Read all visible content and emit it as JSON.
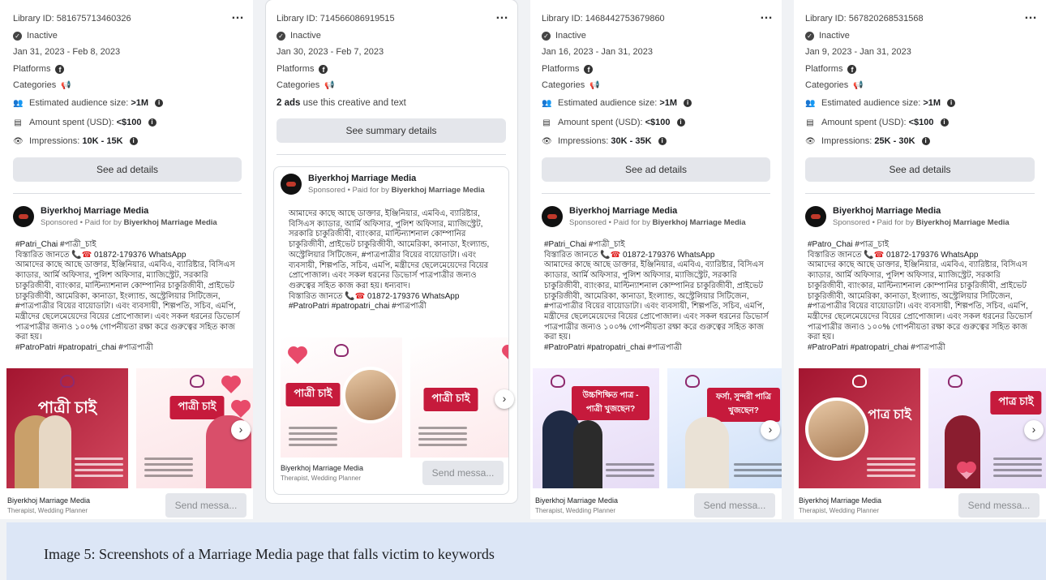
{
  "cards": [
    {
      "library_id": "Library ID: 581675713460326",
      "status": "Inactive",
      "dates": "Jan 31, 2023 - Feb 8, 2023",
      "platforms_label": "Platforms",
      "categories_label": "Categories",
      "audience_label": "Estimated audience size:",
      "audience_value": ">1M",
      "amount_label": "Amount spent (USD):",
      "amount_value": "<$100",
      "impressions_label": "Impressions:",
      "impressions_value": "10K - 15K",
      "details_button": "See ad details",
      "page_name": "Biyerkhoj Marriage Media",
      "sponsored": "Sponsored • Paid for by",
      "paid_by": "Biyerkhoj Marriage Media",
      "hashtag_top": "#Patri_Chai #পাত্রী_চাই",
      "contact_prefix": "বিস্তারিত জানতে",
      "contact_number": "01872-179376 WhatsApp",
      "body_text": "আমাদের কাছে আছে ডাক্তার, ইঞ্জিনিয়ার, এমবিএ, ব্যারিষ্টার, বিসিএস ক্যাডার, আর্মি অফিসার, পুলিশ অফিসার, ম্যাজিস্ট্রেট, সরকারি চাকুরিজীবী, ব্যাংকার, মাল্টিন্যাশনাল কোম্পানির চাকুরিজীবী, প্রাইভেট চাকুরিজীবী, আমেরিকা, কানাডা, ইংল্যান্ড, অস্ট্রেলিয়ার সিটিজেন, #পাত্রপাত্রীর বিয়ের বায়োডাটা। এবং ব্যবসায়ী, শিল্পপতি, সচিব, এমপি, মন্ত্রীদের ছেলেমেয়েদের বিয়ের প্রোপোজাল। এবং সকল ধরনের ডিভোর্স পাত্রপাত্রীর জন্যও ১০০% গোপনীয়তা রক্ষা করে গুরুত্বের সহিত কাজ করা হয়।",
      "hashtag_bottom": "#PatroPatri #patropatri_chai #পাত্রপাত্রী",
      "slide_tags": [
        "পাত্রী চাই",
        "পাত্রী চাই"
      ],
      "footer_name": "Biyerkhoj Marriage Media",
      "footer_sub": "Therapist, Wedding Planner",
      "send_button": "Send messa..."
    },
    {
      "library_id": "Library ID: 714566086919515",
      "status": "Inactive",
      "dates": "Jan 30, 2023 - Feb 7, 2023",
      "platforms_label": "Platforms",
      "categories_label": "Categories",
      "ads_count": "2 ads",
      "ads_rest": "use this creative and text",
      "summary_button": "See summary details",
      "page_name": "Biyerkhoj Marriage Media",
      "sponsored": "Sponsored • Paid for by",
      "paid_by": "Biyerkhoj Marriage Media",
      "body_text": "আমাদের কাছে আছে ডাক্তার, ইঞ্জিনিয়ার, এমবিএ, ব্যারিষ্টার, বিসিএস ক্যাডার, আর্মি অফিসার, পুলিশ অফিসার, ম্যাজিস্ট্রেট, সরকারি চাকুরিজীবী, ব্যাংকার, মাল্টিন্যাশনাল কোম্পানির চাকুরিজীবী, প্রাইভেট চাকুরিজীবী, আমেরিকা, কানাডা, ইংল্যান্ড, অস্ট্রেলিয়ার সিটিজেন, #পাত্রপাত্রীর বিয়ের বায়োডাটা। এবং ব্যবসায়ী, শিল্পপতি, সচিব, এমপি, মন্ত্রীদের ছেলেমেয়েদের বিয়ের প্রোপোজাল। এবং সকল ধরনের ডিভোর্স পাত্রপাত্রীর জন্যও গুরুত্বের সহিত কাজ করা হয়। ধন্যবাদ।",
      "contact_prefix": "বিস্তারিত জানতে",
      "contact_number": "01872-179376 WhatsApp",
      "hashtag_bottom": "#PatroPatri #patropatri_chai #পাত্রপাত্রী",
      "slide_tags": [
        "পাত্রী চাই",
        "পাত্রী চাই"
      ],
      "footer_name": "Biyerkhoj Marriage Media",
      "footer_sub": "Therapist, Wedding Planner",
      "send_button": "Send messa..."
    },
    {
      "library_id": "Library ID: 1468442753679860",
      "status": "Inactive",
      "dates": "Jan 16, 2023 - Jan 31, 2023",
      "platforms_label": "Platforms",
      "categories_label": "Categories",
      "audience_label": "Estimated audience size:",
      "audience_value": ">1M",
      "amount_label": "Amount spent (USD):",
      "amount_value": "<$100",
      "impressions_label": "Impressions:",
      "impressions_value": "30K - 35K",
      "details_button": "See ad details",
      "page_name": "Biyerkhoj Marriage Media",
      "sponsored": "Sponsored • Paid for by",
      "paid_by": "Biyerkhoj Marriage Media",
      "hashtag_top": "#Patri_Chai #পাত্রী_চাই",
      "contact_prefix": "বিস্তারিত জানতে",
      "contact_number": "01872-179376 WhatsApp",
      "body_text": "আমাদের কাছে আছে ডাক্তার, ইঞ্জিনিয়ার, এমবিএ, ব্যারিষ্টার, বিসিএস ক্যাডার, আর্মি অফিসার, পুলিশ অফিসার, ম্যাজিস্ট্রেট, সরকারি চাকুরিজীবী, ব্যাংকার, মাল্টিন্যাশনাল কোম্পানির চাকুরিজীবী, প্রাইভেট চাকুরিজীবী, আমেরিকা, কানাডা, ইংল্যান্ড, অস্ট্রেলিয়ার সিটিজেন, #পাত্রপাত্রীর বিয়ের বায়োডাটা। এবং ব্যবসায়ী, শিল্পপতি, সচিব, এমপি, মন্ত্রীদের ছেলেমেয়েদের বিয়ের প্রোপোজাল। এবং সকল ধরনের ডিভোর্স পাত্রপাত্রীর জন্যও ১০০% গোপনীয়তা রক্ষা করে গুরুত্বের সহিত কাজ করা হয়।",
      "hashtag_bottom": "#PatroPatri #patropatri_chai #পাত্রপাত্রী",
      "slide_tags": [
        "উচ্চশিক্ষিত পাত্র - পাত্রী খুজছেন?",
        "ফর্সা, সুন্দরী পাত্রি খুজছেন?"
      ],
      "footer_name": "Biyerkhoj Marriage Media",
      "footer_sub": "Therapist, Wedding Planner",
      "send_button": "Send messa..."
    },
    {
      "library_id": "Library ID: 567820268531568",
      "status": "Inactive",
      "dates": "Jan 9, 2023 - Jan 31, 2023",
      "platforms_label": "Platforms",
      "categories_label": "Categories",
      "audience_label": "Estimated audience size:",
      "audience_value": ">1M",
      "amount_label": "Amount spent (USD):",
      "amount_value": "<$100",
      "impressions_label": "Impressions:",
      "impressions_value": "25K - 30K",
      "details_button": "See ad details",
      "page_name": "Biyerkhoj Marriage Media",
      "sponsored": "Sponsored • Paid for by",
      "paid_by": "Biyerkhoj Marriage Media",
      "hashtag_top": "#Patro_Chai #পাত্র_চাই",
      "contact_prefix": "বিস্তারিত জানতে",
      "contact_number": "01872-179376 WhatsApp",
      "body_text": "আমাদের কাছে আছে ডাক্তার, ইঞ্জিনিয়ার, এমবিএ, ব্যারিষ্টার, বিসিএস ক্যাডার, আর্মি অফিসার, পুলিশ অফিসার, ম্যাজিস্ট্রেট, সরকারি চাকুরিজীবী, ব্যাংকার, মাল্টিন্যাশনাল কোম্পানির চাকুরিজীবী, প্রাইভেট চাকুরিজীবী, আমেরিকা, কানাডা, ইংল্যান্ড, অস্ট্রেলিয়ার সিটিজেন, #পাত্রপাত্রীর বিয়ের বায়োডাটা। এবং ব্যবসায়ী, শিল্পপতি, সচিব, এমপি, মন্ত্রীদের ছেলেমেয়েদের বিয়ের প্রোপোজাল। এবং সকল ধরনের ডিভোর্স পাত্রপাত্রীর জন্যও ১০০% গোপনীয়তা রক্ষা করে গুরুত্বের সহিত কাজ করা হয়।",
      "hashtag_bottom": "#PatroPatri #patropatri_chai #পাত্রপাত্রী",
      "slide_tags": [
        "পাত্র চাই",
        "পাত্র চাই"
      ],
      "footer_name": "Biyerkhoj Marriage Media",
      "footer_sub": "Therapist, Wedding Planner",
      "send_button": "Send messa..."
    }
  ],
  "more_icon": "…",
  "caption": "Image 5: Screenshots of a Marriage Media page that falls victim to keywords",
  "icons": {
    "status": "inactive-check-icon",
    "platform": "facebook-icon",
    "category": "megaphone-icon",
    "audience": "people-icon",
    "amount": "receipt-icon",
    "impressions": "eye-icon",
    "info": "info-icon",
    "next": "chevron-right-icon"
  }
}
